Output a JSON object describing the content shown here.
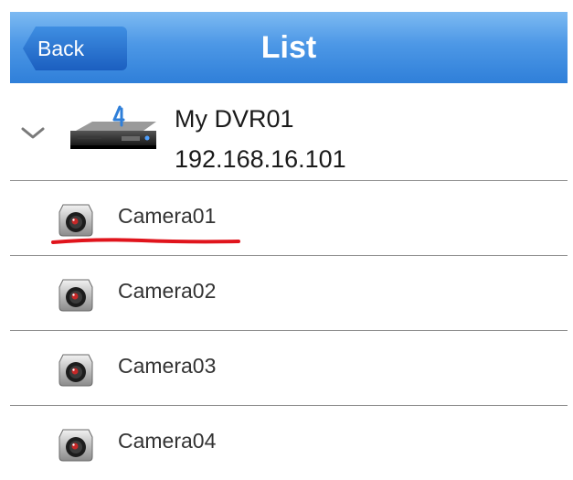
{
  "navbar": {
    "back_label": "Back",
    "title": "List"
  },
  "device": {
    "name": "My DVR01",
    "ip": "192.168.16.101",
    "expanded": true,
    "icon": "dvr-icon",
    "badge_glyph": "4"
  },
  "cameras": [
    {
      "label": "Camera01",
      "icon": "camera-icon",
      "highlighted": true
    },
    {
      "label": "Camera02",
      "icon": "camera-icon"
    },
    {
      "label": "Camera03",
      "icon": "camera-icon"
    },
    {
      "label": "Camera04",
      "icon": "camera-icon"
    }
  ],
  "colors": {
    "navbar_gradient": [
      "#7dbaf2",
      "#2f7fd9"
    ],
    "back_button": "#1b5fc0",
    "annotation": "#e0141c",
    "divider": "#8e8e8e"
  }
}
